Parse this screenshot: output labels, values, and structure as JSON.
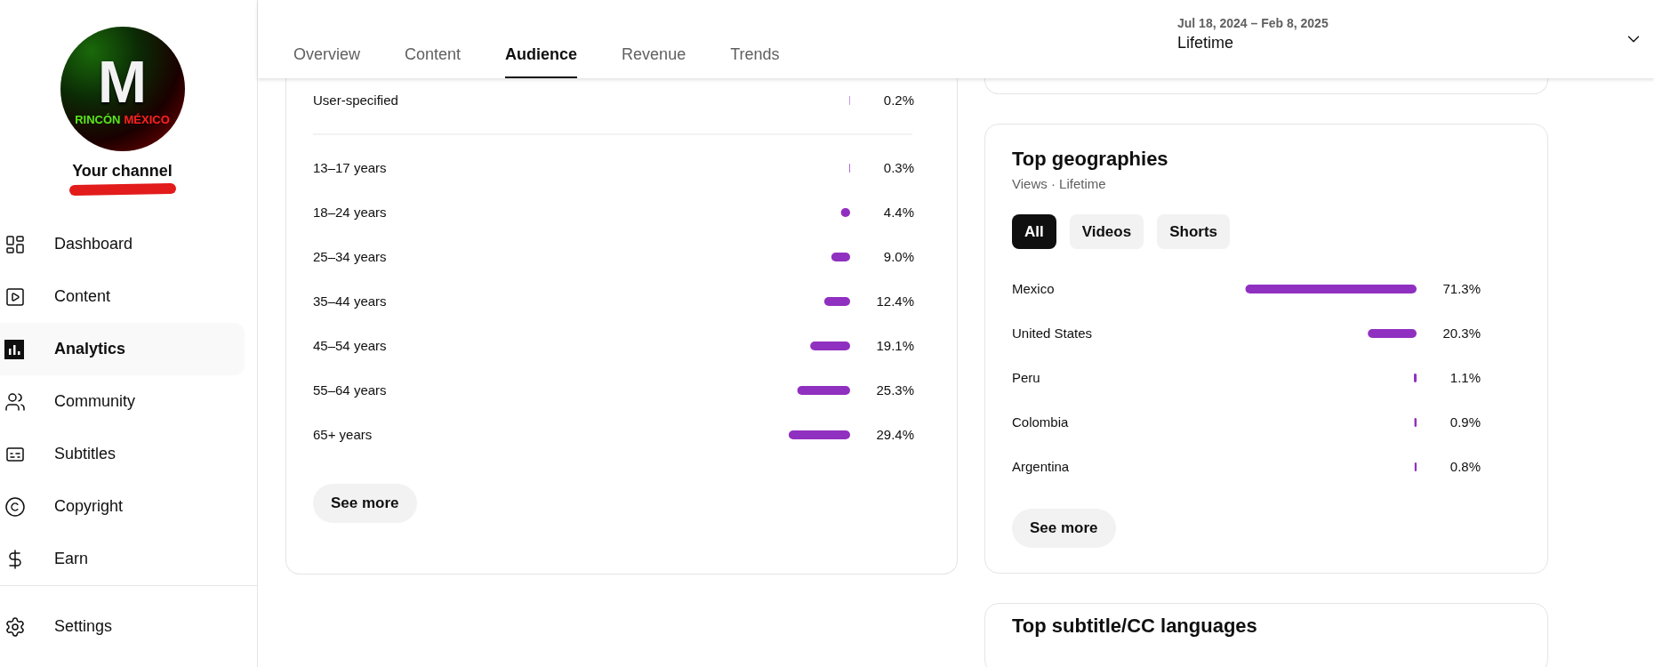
{
  "channel": {
    "logo_letter": "M",
    "logo_words": [
      "RINCÓN",
      "MÉXICO"
    ],
    "label": "Your channel",
    "name_redacted": true
  },
  "nav": [
    {
      "label": "Dashboard",
      "kind": "dashboard",
      "selected": false
    },
    {
      "label": "Content",
      "kind": "content",
      "selected": false
    },
    {
      "label": "Analytics",
      "kind": "analytics",
      "selected": true
    },
    {
      "label": "Community",
      "kind": "community",
      "selected": false
    },
    {
      "label": "Subtitles",
      "kind": "subtitles",
      "selected": false
    },
    {
      "label": "Copyright",
      "kind": "copyright",
      "selected": false
    },
    {
      "label": "Earn",
      "kind": "earn",
      "selected": false
    }
  ],
  "settings": {
    "label": "Settings"
  },
  "tabs": [
    {
      "label": "Overview",
      "selected": false
    },
    {
      "label": "Content",
      "selected": false
    },
    {
      "label": "Audience",
      "selected": true
    },
    {
      "label": "Revenue",
      "selected": false
    },
    {
      "label": "Trends",
      "selected": false
    }
  ],
  "date_range": {
    "range": "Jul 18, 2024 – Feb 8, 2025",
    "period": "Lifetime"
  },
  "age": {
    "chart_data": {
      "type": "bar",
      "orientation": "horizontal",
      "categories": [
        "User-specified",
        "13–17 years",
        "18–24 years",
        "25–34 years",
        "35–44 years",
        "45–54 years",
        "55–64 years",
        "65+ years"
      ],
      "values": [
        0.2,
        0.3,
        4.4,
        9.0,
        12.4,
        19.1,
        25.3,
        29.4
      ],
      "value_labels": [
        "0.2%",
        "0.3%",
        "4.4%",
        "9.0%",
        "12.4%",
        "19.1%",
        "25.3%",
        "29.4%"
      ]
    }
  },
  "age_see_more": "See more",
  "geographies": {
    "title": "Top geographies",
    "subtitle": "Views · Lifetime",
    "chips": [
      {
        "label": "All",
        "selected": true
      },
      {
        "label": "Videos",
        "selected": false
      },
      {
        "label": "Shorts",
        "selected": false
      }
    ],
    "chart_data": {
      "type": "bar",
      "orientation": "horizontal",
      "categories": [
        "Mexico",
        "United States",
        "Peru",
        "Colombia",
        "Argentina"
      ],
      "values": [
        71.3,
        20.3,
        1.1,
        0.9,
        0.8
      ],
      "value_labels": [
        "71.3%",
        "20.3%",
        "1.1%",
        "0.9%",
        "0.8%"
      ]
    },
    "see_more": "See more"
  },
  "subtitle_card": {
    "title": "Top subtitle/CC languages"
  }
}
